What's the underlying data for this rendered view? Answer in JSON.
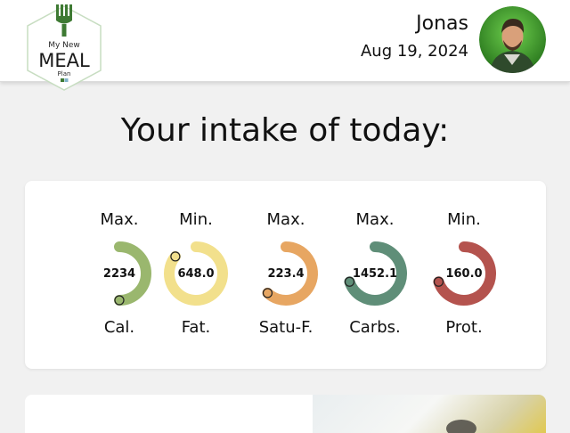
{
  "header": {
    "logo": {
      "line1": "My New",
      "line2": "MEAL",
      "line3": "Plan"
    },
    "user_name": "Jonas",
    "date": "Aug 19, 2024"
  },
  "main": {
    "title": "Your intake of today:"
  },
  "gauges": [
    {
      "limit": "Max.",
      "value": "2234",
      "label": "Cal.",
      "progress": 0.5,
      "color": "#9ab76e"
    },
    {
      "limit": "Min.",
      "value": "648.0",
      "label": "Fat.",
      "progress": 0.86,
      "color": "#f2e08c"
    },
    {
      "limit": "Max.",
      "value": "223.4",
      "label": "Satu-F.",
      "progress": 0.62,
      "color": "#e7a662"
    },
    {
      "limit": "Max.",
      "value": "1452.1",
      "label": "Carbs.",
      "progress": 0.7,
      "color": "#5f8e78"
    },
    {
      "limit": "Min.",
      "value": "160.0",
      "label": "Prot.",
      "progress": 0.7,
      "color": "#b4534e"
    }
  ],
  "colors": {
    "brand_green": "#3e7a33",
    "avatar_bg": "#3a9a26"
  }
}
